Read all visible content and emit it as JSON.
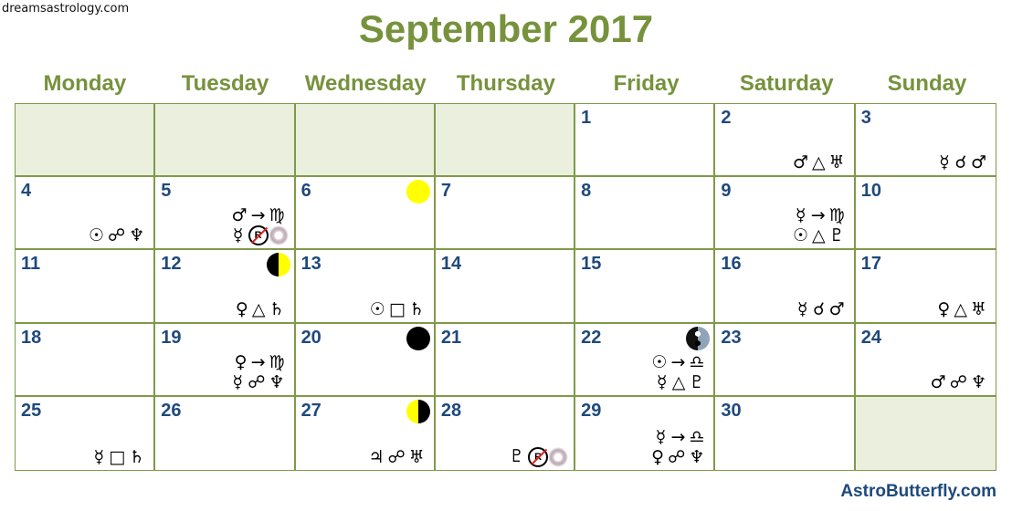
{
  "watermark": "dreamsastrology.com",
  "title": "September 2017",
  "day_headers": [
    "Monday",
    "Tuesday",
    "Wednesday",
    "Thursday",
    "Friday",
    "Saturday",
    "Sunday"
  ],
  "footer": "AstroButterfly.com",
  "colors": {
    "title_green": "#76923c",
    "daynum_blue": "#1f497d",
    "grid_border": "#7f9a48",
    "empty_cell": "#ebf0de",
    "moon_yellow": "#ffff00"
  },
  "cells": [
    {
      "day": "",
      "moon": "",
      "lines": []
    },
    {
      "day": "",
      "moon": "",
      "lines": []
    },
    {
      "day": "",
      "moon": "",
      "lines": []
    },
    {
      "day": "",
      "moon": "",
      "lines": []
    },
    {
      "day": "1",
      "moon": "",
      "lines": []
    },
    {
      "day": "2",
      "moon": "",
      "lines": [
        [
          "♂",
          "△",
          "♅"
        ]
      ]
    },
    {
      "day": "3",
      "moon": "",
      "lines": [
        [
          "☿",
          "☌",
          "♂"
        ]
      ]
    },
    {
      "day": "4",
      "moon": "",
      "lines": [
        [
          "☉",
          "☍",
          "♆"
        ]
      ]
    },
    {
      "day": "5",
      "moon": "",
      "lines": [
        [
          "♂",
          "→",
          "♍"
        ],
        [
          "☿",
          "Rx-end",
          "station"
        ]
      ]
    },
    {
      "day": "6",
      "moon": "full",
      "lines": []
    },
    {
      "day": "7",
      "moon": "",
      "lines": []
    },
    {
      "day": "8",
      "moon": "",
      "lines": []
    },
    {
      "day": "9",
      "moon": "",
      "lines": [
        [
          "☿",
          "→",
          "♍"
        ],
        [
          "☉",
          "△",
          "♇"
        ]
      ]
    },
    {
      "day": "10",
      "moon": "",
      "lines": []
    },
    {
      "day": "11",
      "moon": "",
      "lines": []
    },
    {
      "day": "12",
      "moon": "last",
      "lines": [
        [
          "♀",
          "△",
          "♄"
        ]
      ]
    },
    {
      "day": "13",
      "moon": "",
      "lines": [
        [
          "☉",
          "□",
          "♄"
        ]
      ]
    },
    {
      "day": "14",
      "moon": "",
      "lines": []
    },
    {
      "day": "15",
      "moon": "",
      "lines": []
    },
    {
      "day": "16",
      "moon": "",
      "lines": [
        [
          "☿",
          "☌",
          "♂"
        ]
      ]
    },
    {
      "day": "17",
      "moon": "",
      "lines": [
        [
          "♀",
          "△",
          "♅"
        ]
      ]
    },
    {
      "day": "18",
      "moon": "",
      "lines": []
    },
    {
      "day": "19",
      "moon": "",
      "lines": [
        [
          "♀",
          "→",
          "♍"
        ],
        [
          "☿",
          "☍",
          "♆"
        ]
      ]
    },
    {
      "day": "20",
      "moon": "new",
      "lines": []
    },
    {
      "day": "21",
      "moon": "",
      "lines": []
    },
    {
      "day": "22",
      "moon": "equinox",
      "lines": [
        [
          "☉",
          "→",
          "♎"
        ],
        [
          "☿",
          "△",
          "♇"
        ]
      ]
    },
    {
      "day": "23",
      "moon": "",
      "lines": []
    },
    {
      "day": "24",
      "moon": "",
      "lines": [
        [
          "♂",
          "☍",
          "♆"
        ]
      ]
    },
    {
      "day": "25",
      "moon": "",
      "lines": [
        [
          "☿",
          "□",
          "♄"
        ]
      ]
    },
    {
      "day": "26",
      "moon": "",
      "lines": []
    },
    {
      "day": "27",
      "moon": "first",
      "lines": [
        [
          "♃",
          "☍",
          "♅"
        ]
      ]
    },
    {
      "day": "28",
      "moon": "",
      "lines": [
        [
          "♇",
          "Rx-end",
          "station"
        ]
      ]
    },
    {
      "day": "29",
      "moon": "",
      "lines": [
        [
          "☿",
          "→",
          "♎"
        ],
        [
          "♀",
          "☍",
          "♆"
        ]
      ]
    },
    {
      "day": "30",
      "moon": "",
      "lines": []
    },
    {
      "day": "",
      "moon": "",
      "lines": []
    }
  ]
}
